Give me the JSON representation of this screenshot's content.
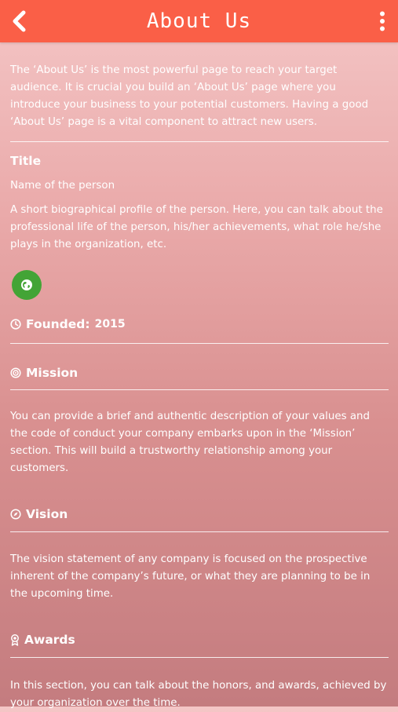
{
  "header": {
    "title": "About Us",
    "back_icon": "chevron-left-icon",
    "menu_icon": "kebab-menu-icon",
    "color": "#fa5f47"
  },
  "intro": "The ‘About Us’ is the most powerful page to reach your target audience. It is crucial you build an ‘About Us’ page where you introduce your business to your potential customers. Having a good ‘About Us’ page is a vital component to attract new users.",
  "person": {
    "title": "Title",
    "name": "Name of the person",
    "bio": "A short biographical profile of the person. Here, you can talk about the professional life of the person, his/her achievements, what role he/she plays in the organization, etc.",
    "link_icon": "globe-icon",
    "link_color": "#43a436"
  },
  "founded": {
    "label": "Founded:",
    "year": "2015",
    "icon": "clock-icon"
  },
  "mission": {
    "label": "Mission",
    "icon": "target-icon",
    "text": "You can provide a brief and authentic description of your values and the code of conduct your company embarks upon in the ‘Mission’ section. This will build a trustworthy relationship among your customers."
  },
  "vision": {
    "label": "Vision",
    "icon": "compass-icon",
    "text": "The vision statement of any company is focused on the prospective inherent of the company’s future, or what they are planning to be in the upcoming time."
  },
  "awards": {
    "label": "Awards",
    "icon": "award-icon",
    "text": "In this section, you can talk about the honors, and awards, achieved by your organization over the time."
  }
}
